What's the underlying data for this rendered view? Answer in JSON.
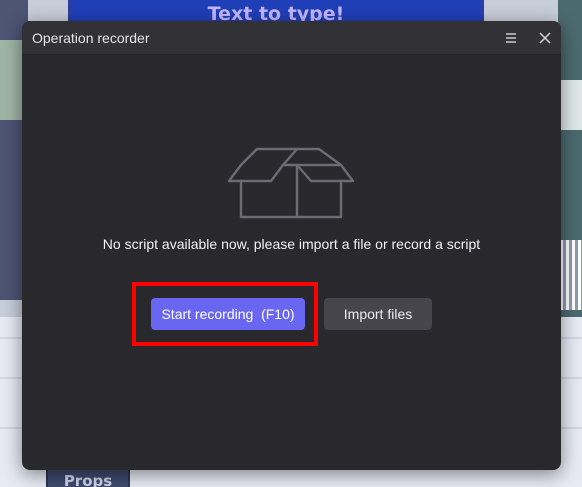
{
  "background": {
    "banner_text": "Text to type!",
    "props_text": "Props"
  },
  "window": {
    "title": "Operation recorder",
    "menu_icon": "hamburger-menu-icon",
    "close_icon": "close-icon"
  },
  "empty_state": {
    "icon": "empty-box-icon",
    "message": "No script available now, please import a file or record a script"
  },
  "actions": {
    "start_recording_label": "Start recording  (F10)",
    "import_files_label": "Import files"
  },
  "colors": {
    "window_bg": "#29282d",
    "titlebar_bg": "#323136",
    "accent": "#6966f2",
    "secondary_button": "#46454b",
    "highlight_border": "#ff0000"
  }
}
